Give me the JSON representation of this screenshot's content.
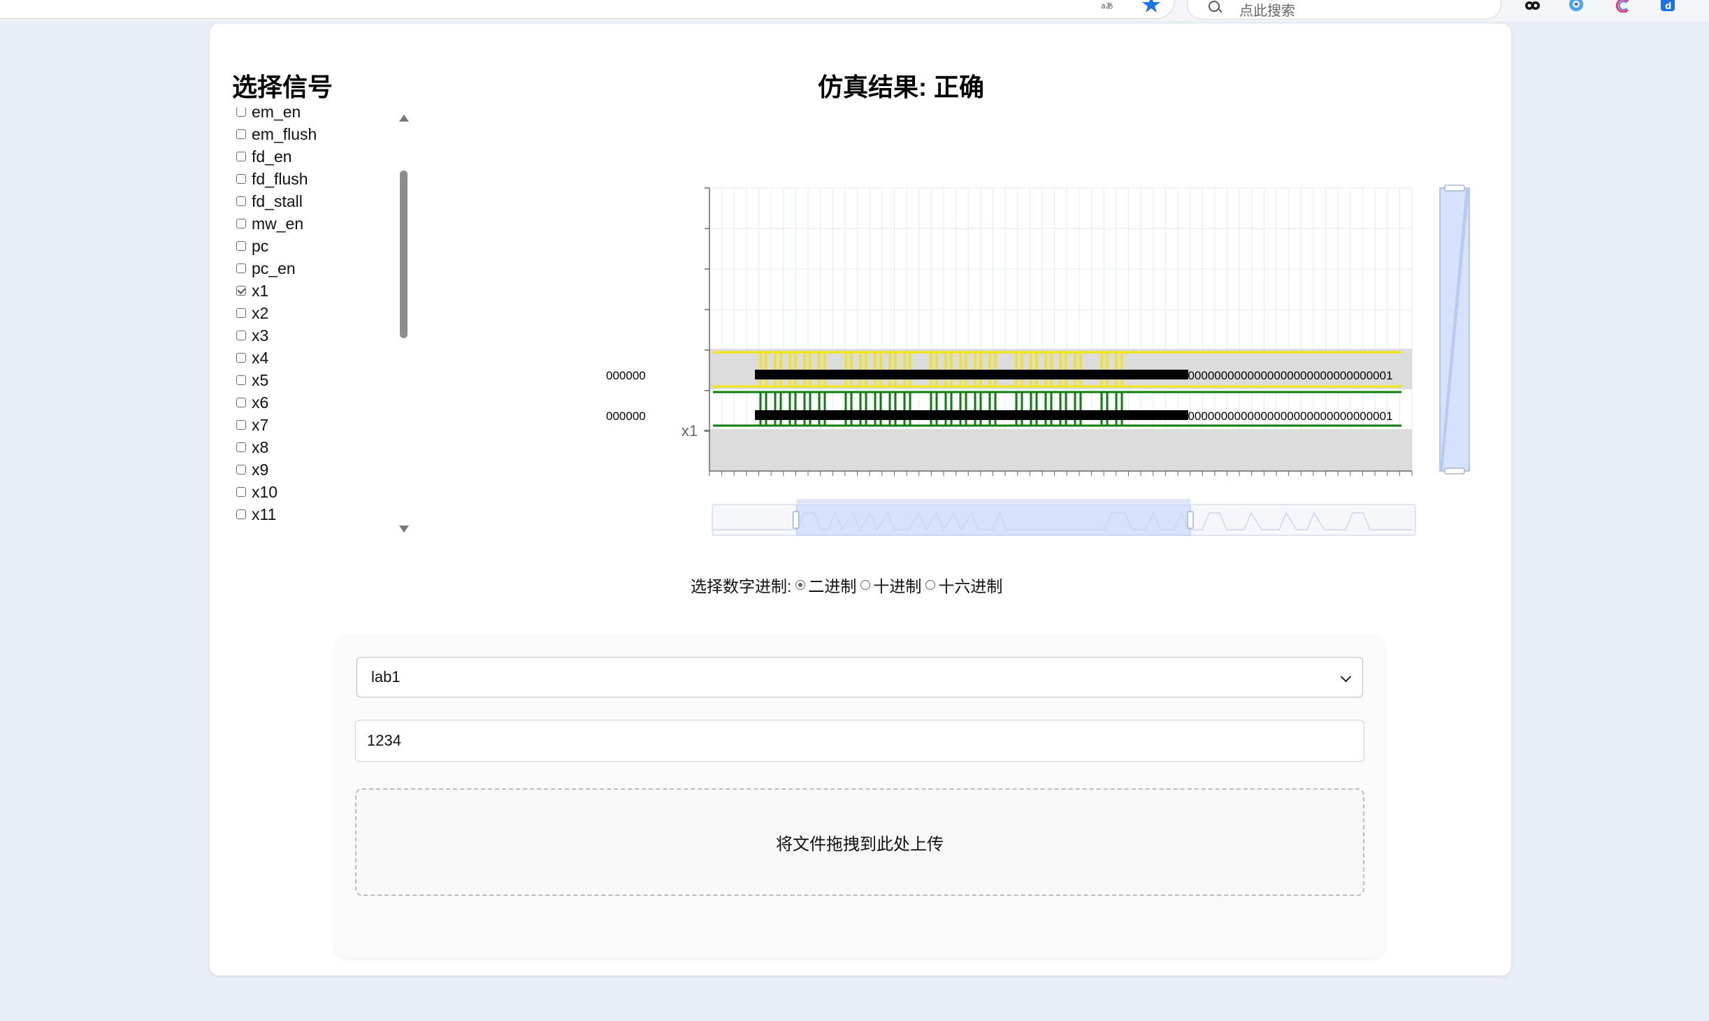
{
  "browser": {
    "search_placeholder": "点此搜索",
    "toolbar_icons": [
      "translate-icon",
      "bookmark-star-icon",
      "extension-icon-1",
      "extension-icon-2",
      "extension-icon-3",
      "extension-icon-4"
    ]
  },
  "signal_panel": {
    "title": "选择信号",
    "items": [
      {
        "label": "em_en",
        "checked": false
      },
      {
        "label": "em_flush",
        "checked": false
      },
      {
        "label": "fd_en",
        "checked": false
      },
      {
        "label": "fd_flush",
        "checked": false
      },
      {
        "label": "fd_stall",
        "checked": false
      },
      {
        "label": "mw_en",
        "checked": false
      },
      {
        "label": "pc",
        "checked": false
      },
      {
        "label": "pc_en",
        "checked": false
      },
      {
        "label": "x1",
        "checked": true
      },
      {
        "label": "x2",
        "checked": false
      },
      {
        "label": "x3",
        "checked": false
      },
      {
        "label": "x4",
        "checked": false
      },
      {
        "label": "x5",
        "checked": false
      },
      {
        "label": "x6",
        "checked": false
      },
      {
        "label": "x7",
        "checked": false
      },
      {
        "label": "x8",
        "checked": false
      },
      {
        "label": "x9",
        "checked": false
      },
      {
        "label": "x10",
        "checked": false
      },
      {
        "label": "x11",
        "checked": false
      }
    ]
  },
  "simulation": {
    "title": "仿真结果: 正确",
    "waveform": {
      "signal_label": "x1",
      "row1_value_text": "00000000000000000000000000000001",
      "row2_value_text": "00000000000000000000000000000001",
      "row1_left_text": "000000",
      "row2_left_text": "000000",
      "row1_color": "#f2e600",
      "row2_color": "#0a7d0a",
      "transitions": 22,
      "zoom_window": [
        0.12,
        0.68
      ]
    }
  },
  "radix": {
    "label": "选择数字进制:",
    "options": [
      {
        "label": "二进制",
        "selected": true
      },
      {
        "label": "十进制",
        "selected": false
      },
      {
        "label": "十六进制",
        "selected": false
      }
    ]
  },
  "form": {
    "lab_select": "lab1",
    "id_input": "1234",
    "dropzone_text": "将文件拖拽到此处上传"
  },
  "colors": {
    "accent_blue": "#1a73e8",
    "zoom_fill": "#d6e2fb",
    "band_gray": "#dcdcdc"
  }
}
